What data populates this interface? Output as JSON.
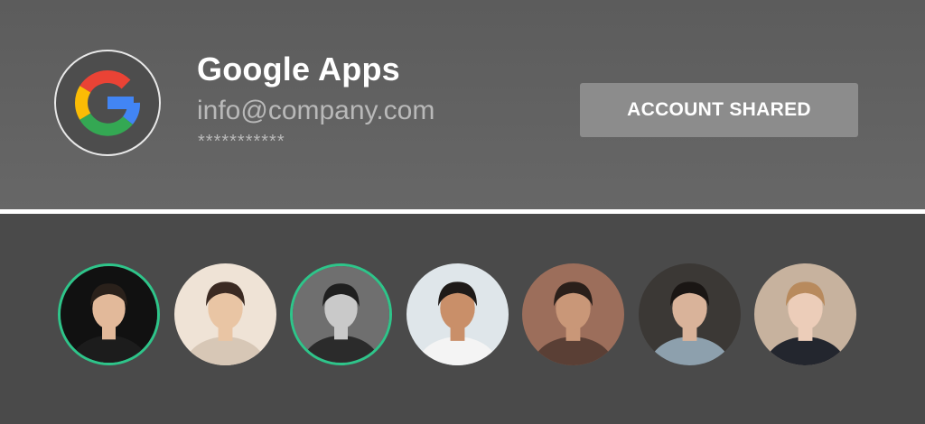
{
  "app": {
    "name": "Google Apps",
    "email": "info@company.com",
    "password_mask": "***********",
    "logo_icon": "google-g-icon",
    "logo_colors": {
      "red": "#ea4335",
      "yellow": "#fbbc05",
      "green": "#34a853",
      "blue": "#4285f4"
    }
  },
  "share_button": {
    "label": "ACCOUNT SHARED"
  },
  "accent_color": "#2ec58a",
  "members": [
    {
      "name": "member-1",
      "selected": true,
      "skin": "#e2b99a",
      "hair": "#2a211b",
      "shirt": "#1c1c1c",
      "bg": "#111111"
    },
    {
      "name": "member-2",
      "selected": false,
      "skin": "#e9c5a4",
      "hair": "#3b2a22",
      "shirt": "#d7c7b6",
      "bg": "#efe3d6"
    },
    {
      "name": "member-3",
      "selected": true,
      "skin": "#c9c9c9",
      "hair": "#1f1f1f",
      "shirt": "#2b2b2b",
      "bg": "#6f6f6f"
    },
    {
      "name": "member-4",
      "selected": false,
      "skin": "#c98f69",
      "hair": "#1e1a18",
      "shirt": "#f4f4f4",
      "bg": "#dfe6ea"
    },
    {
      "name": "member-5",
      "selected": false,
      "skin": "#c99778",
      "hair": "#2a1f1a",
      "shirt": "#5a3f35",
      "bg": "#9c6e5b"
    },
    {
      "name": "member-6",
      "selected": false,
      "skin": "#d9b39a",
      "hair": "#1a1614",
      "shirt": "#8da0ad",
      "bg": "#3b3835"
    },
    {
      "name": "member-7",
      "selected": false,
      "skin": "#eccdb9",
      "hair": "#b88a5d",
      "shirt": "#23262e",
      "bg": "#c7b29e"
    }
  ]
}
